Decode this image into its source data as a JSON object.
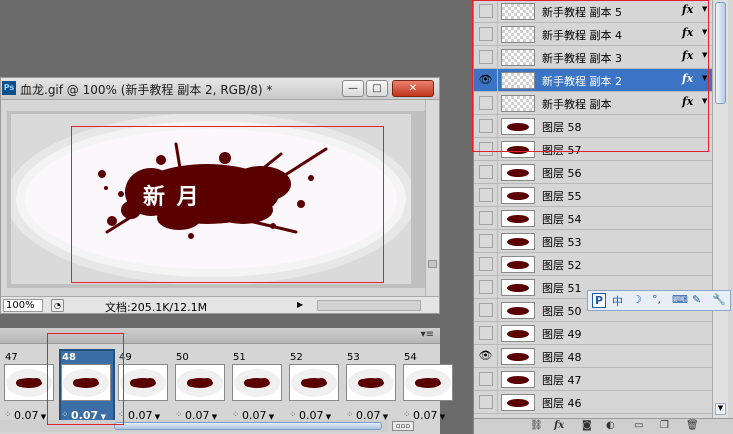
{
  "document": {
    "title": "血龙.gif @ 100% (新手教程 副本 2, RGB/8) *",
    "app_icon": "Ps",
    "image_text": "新 月",
    "zoom": "100%",
    "doc_size": "文档:205.1K/12.1M",
    "window_buttons": {
      "minimize": "—",
      "maximize": "□",
      "close": "✕"
    }
  },
  "animation": {
    "frames": [
      {
        "number": "47",
        "delay": "0.07",
        "selected": false
      },
      {
        "number": "48",
        "delay": "0.07",
        "selected": true
      },
      {
        "number": "49",
        "delay": "0.07",
        "selected": false
      },
      {
        "number": "50",
        "delay": "0.07",
        "selected": false
      },
      {
        "number": "51",
        "delay": "0.07",
        "selected": false
      },
      {
        "number": "52",
        "delay": "0.07",
        "selected": false
      },
      {
        "number": "53",
        "delay": "0.07",
        "selected": false
      },
      {
        "number": "54",
        "delay": "0.07",
        "selected": false
      }
    ]
  },
  "layers": [
    {
      "name": "新手教程 副本 5",
      "visible": false,
      "fx": "fx",
      "type": "transparent",
      "selected": false
    },
    {
      "name": "新手教程 副本 4",
      "visible": false,
      "fx": "fx",
      "type": "transparent",
      "selected": false
    },
    {
      "name": "新手教程 副本 3",
      "visible": false,
      "fx": "fx",
      "type": "transparent",
      "selected": false
    },
    {
      "name": "新手教程 副本 2",
      "visible": true,
      "fx": "fx",
      "type": "transparent",
      "selected": true
    },
    {
      "name": "新手教程 副本",
      "visible": false,
      "fx": "fx",
      "type": "transparent",
      "selected": false
    },
    {
      "name": "图层 58",
      "visible": false,
      "fx": "",
      "type": "image",
      "selected": false
    },
    {
      "name": "图层 57",
      "visible": false,
      "fx": "",
      "type": "image",
      "selected": false
    },
    {
      "name": "图层 56",
      "visible": false,
      "fx": "",
      "type": "image",
      "selected": false
    },
    {
      "name": "图层 55",
      "visible": false,
      "fx": "",
      "type": "image",
      "selected": false
    },
    {
      "name": "图层 54",
      "visible": false,
      "fx": "",
      "type": "image",
      "selected": false
    },
    {
      "name": "图层 53",
      "visible": false,
      "fx": "",
      "type": "image",
      "selected": false
    },
    {
      "name": "图层 52",
      "visible": false,
      "fx": "",
      "type": "image",
      "selected": false
    },
    {
      "name": "图层 51",
      "visible": false,
      "fx": "",
      "type": "image",
      "selected": false
    },
    {
      "name": "图层 50",
      "visible": false,
      "fx": "",
      "type": "image",
      "selected": false
    },
    {
      "name": "图层 49",
      "visible": false,
      "fx": "",
      "type": "image",
      "selected": false
    },
    {
      "name": "图层 48",
      "visible": true,
      "fx": "",
      "type": "image",
      "selected": false
    },
    {
      "name": "图层 47",
      "visible": false,
      "fx": "",
      "type": "image",
      "selected": false
    },
    {
      "name": "图层 46",
      "visible": false,
      "fx": "",
      "type": "image",
      "selected": false
    }
  ],
  "ime_toolbar": {
    "items": [
      "P",
      "中",
      "☽",
      "°,",
      "⌨",
      "✎",
      "🔧"
    ]
  },
  "colors": {
    "blood": "#5a0000",
    "selection_blue": "#3b74c4",
    "annotation_red": "#e0212f"
  }
}
